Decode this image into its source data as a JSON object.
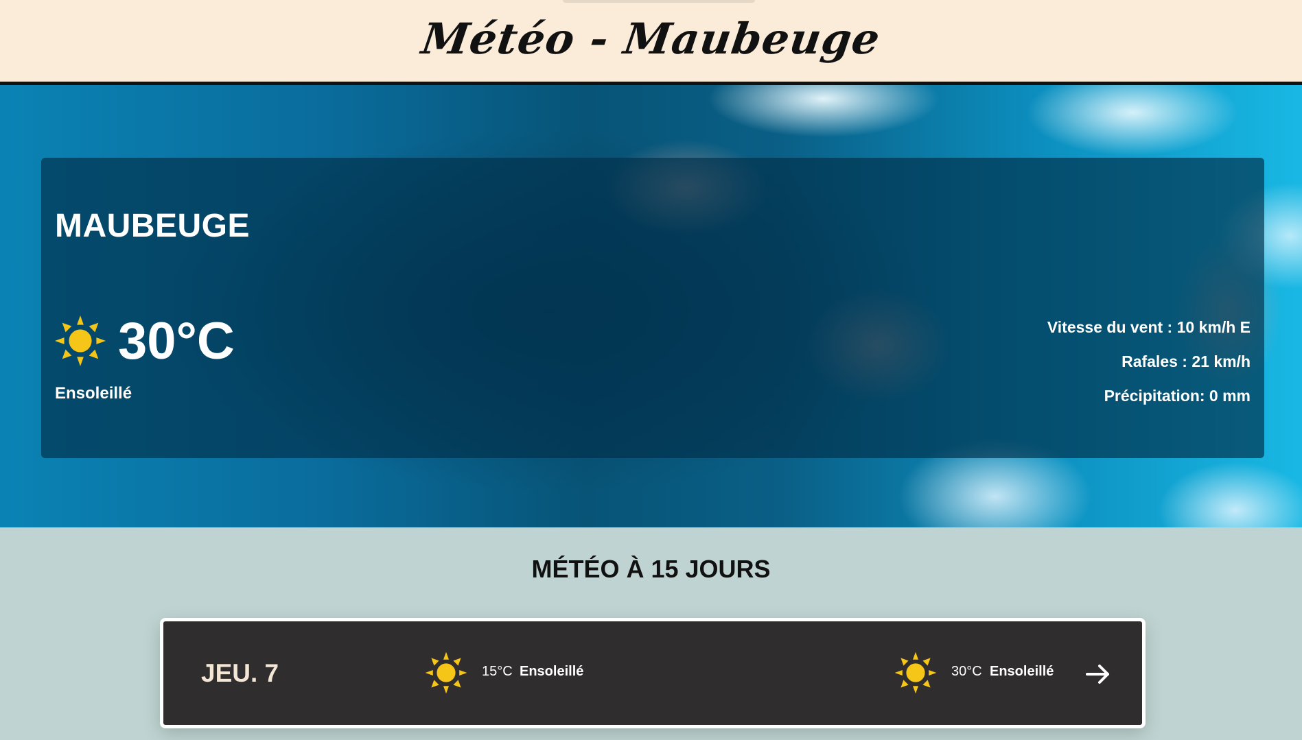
{
  "header": {
    "title": "Météo - Maubeuge"
  },
  "current": {
    "city": "MAUBEUGE",
    "icon": "sun-icon",
    "temperature": "30°C",
    "condition": "Ensoleillé",
    "wind": "Vitesse du vent : 10 km/h E",
    "gusts": "Rafales : 21 km/h",
    "precipitation": "Précipitation: 0 mm"
  },
  "forecast": {
    "title": "MÉTÉO À 15 JOURS",
    "days": [
      {
        "label": "JEU. 7",
        "morning": {
          "icon": "sun-icon",
          "temp": "15°C",
          "condition": "Ensoleillé"
        },
        "afternoon": {
          "icon": "sun-icon",
          "temp": "30°C",
          "condition": "Ensoleillé"
        },
        "more_icon": "arrow-right-icon"
      }
    ]
  },
  "colors": {
    "header_bg": "#fbecd9",
    "sun": "#f5c518",
    "card_bg": "#2f2d2e",
    "page_bg": "#bfd4d2"
  }
}
